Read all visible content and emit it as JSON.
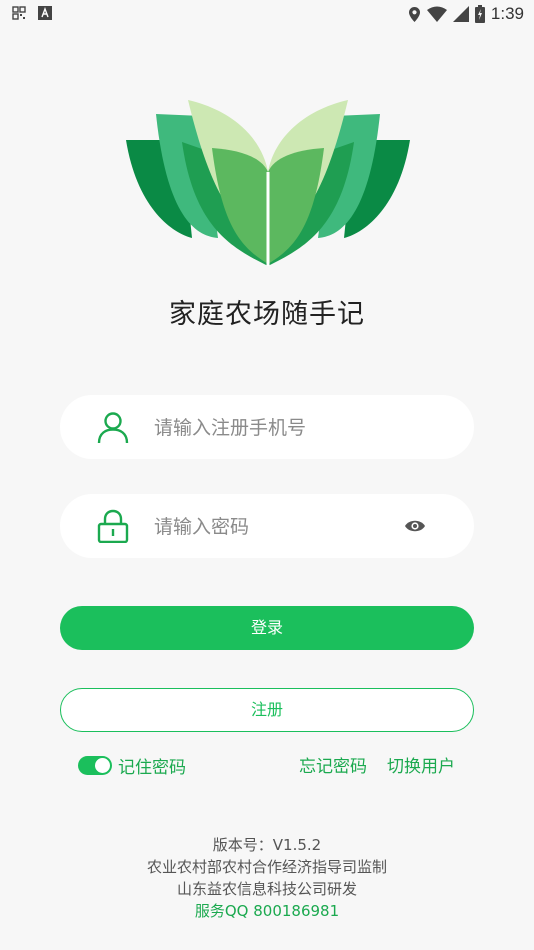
{
  "status_bar": {
    "time": "1:39",
    "left_icons": [
      "qr-grid-icon",
      "font-a-icon"
    ],
    "right_icons": [
      "location-icon",
      "wifi-icon",
      "signal-icon",
      "battery-icon"
    ]
  },
  "app": {
    "title": "家庭农场随手记",
    "logo": "green-book-leaves-logo",
    "accent_color": "#1bbf5c"
  },
  "form": {
    "phone_placeholder": "请输入注册手机号",
    "password_placeholder": "请输入密码",
    "login_label": "登录",
    "register_label": "注册",
    "remember_label": "记住密码",
    "remember_checked": true,
    "forgot_label": "忘记密码",
    "switch_user_label": "切换用户"
  },
  "footer": {
    "version": "版本号：V1.5.2",
    "supervisor": "农业农村部农村合作经济指导司监制",
    "developer": "山东益农信息科技公司研发",
    "service": "服务QQ 800186981"
  }
}
